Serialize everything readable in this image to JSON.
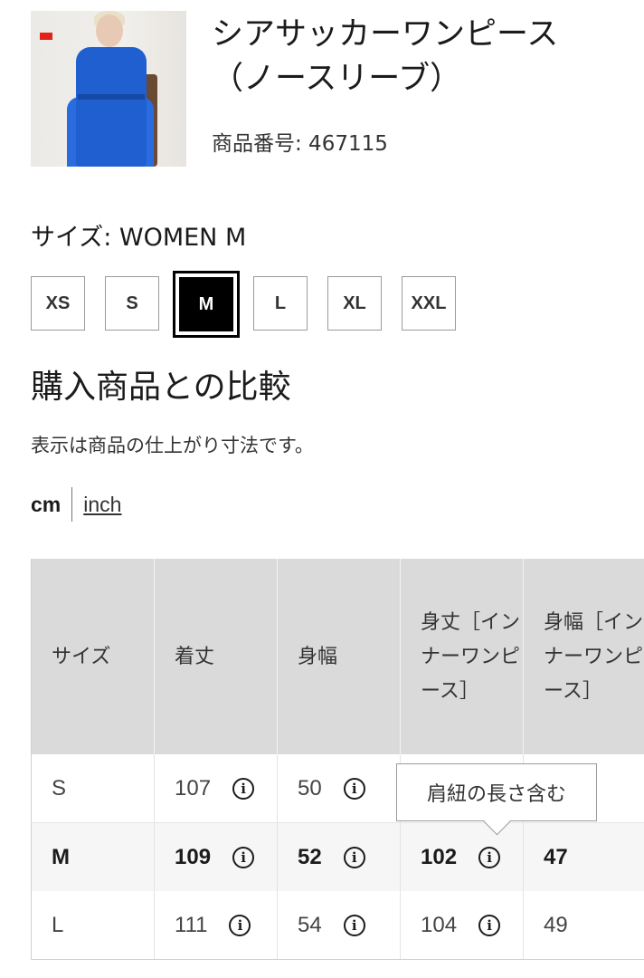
{
  "product": {
    "title": "シアサッカーワンピース\n（ノースリーブ）",
    "product_number_label": "商品番号: 467115"
  },
  "size_selector": {
    "label": "サイズ: WOMEN M",
    "options": [
      "XS",
      "S",
      "M",
      "L",
      "XL",
      "XXL"
    ],
    "selected": "M"
  },
  "comparison": {
    "heading": "購入商品との比較",
    "note": "表示は商品の仕上がり寸法です。",
    "unit_active": "cm",
    "unit_alt": "inch"
  },
  "table": {
    "headers": [
      "サイズ",
      "着丈",
      "身幅",
      "身丈［インナーワンピース］",
      "身幅［インナーワンピース］"
    ],
    "rows": [
      [
        "S",
        "107",
        "50",
        "",
        ""
      ],
      [
        "M",
        "109",
        "52",
        "102",
        "47"
      ],
      [
        "L",
        "111",
        "54",
        "104",
        "49"
      ]
    ]
  },
  "tooltip": {
    "text": "肩紐の長さ含む"
  },
  "colors": {
    "selected_bg": "#000000",
    "header_bg": "#dadada",
    "dress": "#1f5fd0"
  }
}
